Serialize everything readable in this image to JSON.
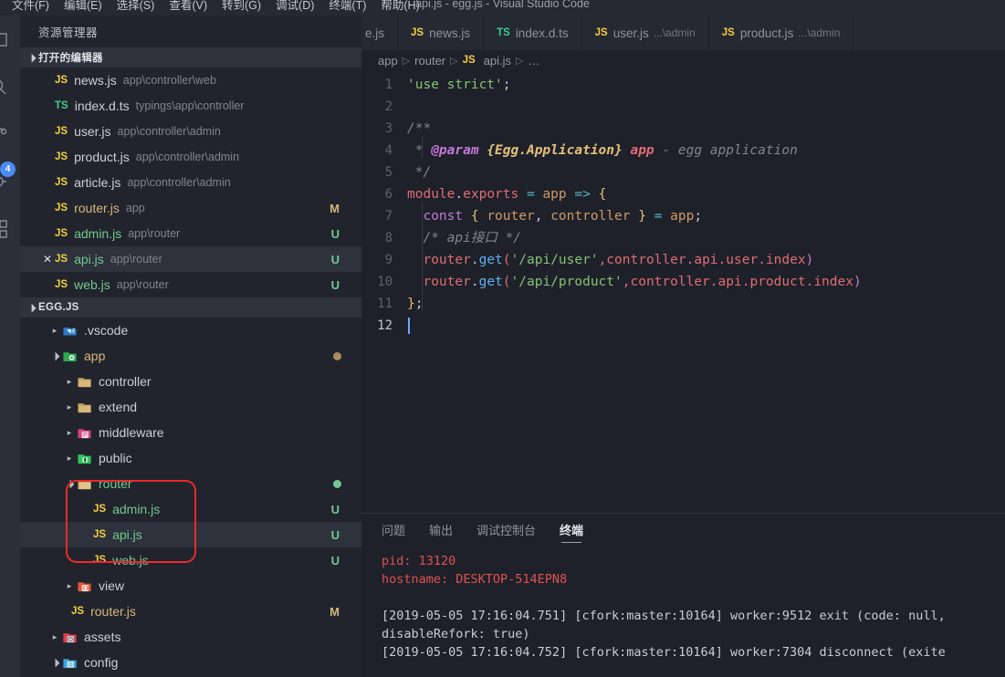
{
  "window": {
    "title": "api.js - egg.js - Visual Studio Code",
    "menus": [
      "文件(F)",
      "编辑(E)",
      "选择(S)",
      "查看(V)",
      "转到(G)",
      "调试(D)",
      "终端(T)",
      "帮助(H)"
    ]
  },
  "activitybar": {
    "items": [
      {
        "name": "explorer-icon",
        "label": "资源管理器"
      },
      {
        "name": "search-icon",
        "label": "搜索"
      },
      {
        "name": "source-control-icon",
        "label": "源代码管理",
        "badge": "4"
      },
      {
        "name": "debug-icon",
        "label": "调试"
      },
      {
        "name": "extensions-icon",
        "label": "扩展"
      }
    ],
    "badge": "4"
  },
  "sidebar": {
    "header": "资源管理器",
    "open_editors": {
      "title": "打开的编辑器",
      "items": [
        {
          "icon": "js",
          "name": "news.js",
          "path": "app\\controller\\web",
          "status": "",
          "active": false,
          "close": false
        },
        {
          "icon": "ts",
          "name": "index.d.ts",
          "path": "typings\\app\\controller",
          "status": "",
          "active": false,
          "close": false
        },
        {
          "icon": "js",
          "name": "user.js",
          "path": "app\\controller\\admin",
          "status": "",
          "active": false,
          "close": false
        },
        {
          "icon": "js",
          "name": "product.js",
          "path": "app\\controller\\admin",
          "status": "",
          "active": false,
          "close": false
        },
        {
          "icon": "js",
          "name": "article.js",
          "path": "app\\controller\\admin",
          "status": "",
          "active": false,
          "close": false
        },
        {
          "icon": "js",
          "name": "router.js",
          "path": "app",
          "status": "M",
          "active": false,
          "close": false
        },
        {
          "icon": "js",
          "name": "admin.js",
          "path": "app\\router",
          "status": "U",
          "active": false,
          "close": false
        },
        {
          "icon": "js",
          "name": "api.js",
          "path": "app\\router",
          "status": "U",
          "active": true,
          "close": true
        },
        {
          "icon": "js",
          "name": "web.js",
          "path": "app\\router",
          "status": "U",
          "active": false,
          "close": false
        }
      ]
    },
    "project": {
      "title": "EGG.JS",
      "tree": [
        {
          "label": ".vscode",
          "kind": "folder",
          "icon": "vscode-folder-icon",
          "indent": 1,
          "expanded": false,
          "status": "",
          "dot": "",
          "color": "plain"
        },
        {
          "label": "app",
          "kind": "folder",
          "icon": "app-folder-icon",
          "indent": 1,
          "expanded": true,
          "status": "",
          "dot": "tan",
          "color": "tan"
        },
        {
          "label": "controller",
          "kind": "folder",
          "icon": "plain-folder-icon",
          "indent": 2,
          "expanded": false,
          "status": "",
          "dot": "",
          "color": "plain"
        },
        {
          "label": "extend",
          "kind": "folder",
          "icon": "plain-folder-icon",
          "indent": 2,
          "expanded": false,
          "status": "",
          "dot": "",
          "color": "plain"
        },
        {
          "label": "middleware",
          "kind": "folder",
          "icon": "middleware-folder-icon",
          "indent": 2,
          "expanded": false,
          "status": "",
          "dot": "",
          "color": "plain"
        },
        {
          "label": "public",
          "kind": "folder",
          "icon": "public-folder-icon",
          "indent": 2,
          "expanded": false,
          "status": "",
          "dot": "",
          "color": "plain"
        },
        {
          "label": "router",
          "kind": "folder",
          "icon": "plain-folder-icon",
          "indent": 2,
          "expanded": true,
          "status": "",
          "dot": "green",
          "color": "green"
        },
        {
          "label": "admin.js",
          "kind": "file",
          "icon": "js",
          "indent": 3,
          "expanded": false,
          "status": "U",
          "dot": "",
          "color": "green"
        },
        {
          "label": "api.js",
          "kind": "file",
          "icon": "js",
          "indent": 3,
          "expanded": false,
          "status": "U",
          "dot": "",
          "color": "green",
          "selected": true
        },
        {
          "label": "web.js",
          "kind": "file",
          "icon": "js",
          "indent": 3,
          "expanded": false,
          "status": "U",
          "dot": "",
          "color": "green"
        },
        {
          "label": "view",
          "kind": "folder",
          "icon": "view-folder-icon",
          "indent": 2,
          "expanded": false,
          "status": "",
          "dot": "",
          "color": "plain"
        },
        {
          "label": "router.js",
          "kind": "file",
          "icon": "js",
          "indent": 2,
          "expanded": false,
          "status": "M",
          "dot": "",
          "color": "tan"
        },
        {
          "label": "assets",
          "kind": "folder",
          "icon": "assets-folder-icon",
          "indent": 1,
          "expanded": false,
          "status": "",
          "dot": "",
          "color": "plain"
        },
        {
          "label": "config",
          "kind": "folder",
          "icon": "config-folder-icon",
          "indent": 1,
          "expanded": true,
          "status": "",
          "dot": "",
          "color": "plain"
        }
      ]
    }
  },
  "editor": {
    "tabs": [
      {
        "icon": "",
        "label": "e.js",
        "sub": "",
        "active": false,
        "clipped": true
      },
      {
        "icon": "js",
        "label": "news.js",
        "sub": "",
        "active": false
      },
      {
        "icon": "ts",
        "label": "index.d.ts",
        "sub": "",
        "active": false
      },
      {
        "icon": "js",
        "label": "user.js",
        "sub": "...\\admin",
        "active": false
      },
      {
        "icon": "js",
        "label": "product.js",
        "sub": "...\\admin",
        "active": false
      }
    ],
    "breadcrumb": [
      "app",
      "router",
      "api.js",
      "…"
    ],
    "breadcrumb_file_icon": "js",
    "lines": [
      {
        "n": "1",
        "current": false
      },
      {
        "n": "2",
        "current": false
      },
      {
        "n": "3",
        "current": false
      },
      {
        "n": "4",
        "current": false
      },
      {
        "n": "5",
        "current": false
      },
      {
        "n": "6",
        "current": false
      },
      {
        "n": "7",
        "current": false
      },
      {
        "n": "8",
        "current": false
      },
      {
        "n": "9",
        "current": false
      },
      {
        "n": "10",
        "current": false
      },
      {
        "n": "11",
        "current": false
      },
      {
        "n": "12",
        "current": true
      }
    ],
    "source_lines": [
      "'use strict';",
      "",
      "/**",
      " * @param {Egg.Application} app - egg application",
      " */",
      "module.exports = app => {",
      "  const { router, controller } = app;",
      "  /* api接口 */",
      "  router.get('/api/user',controller.api.user.index)",
      "  router.get('/api/product',controller.api.product.index)",
      "};",
      ""
    ]
  },
  "panel": {
    "tabs": [
      {
        "label": "问题",
        "active": false
      },
      {
        "label": "输出",
        "active": false
      },
      {
        "label": "调试控制台",
        "active": false
      },
      {
        "label": "终端",
        "active": true
      }
    ],
    "terminal": {
      "pid_line": "pid: 13120",
      "hostname_line": "hostname: DESKTOP-514EPN8",
      "log_lines": [
        "[2019-05-05 17:16:04.751] [cfork:master:10164] worker:9512 exit (code: null,",
        "disableRefork: true)",
        "[2019-05-05 17:16:04.752] [cfork:master:10164] worker:7304 disconnect (exite"
      ]
    }
  },
  "colors": {
    "accent_blue": "#4a8cf7",
    "annotation_red": "#ef2929",
    "status_untracked": "#73c991",
    "status_modified": "#d6b87b",
    "js_icon": "#f4d03f",
    "ts_icon": "#3ecf8e"
  }
}
